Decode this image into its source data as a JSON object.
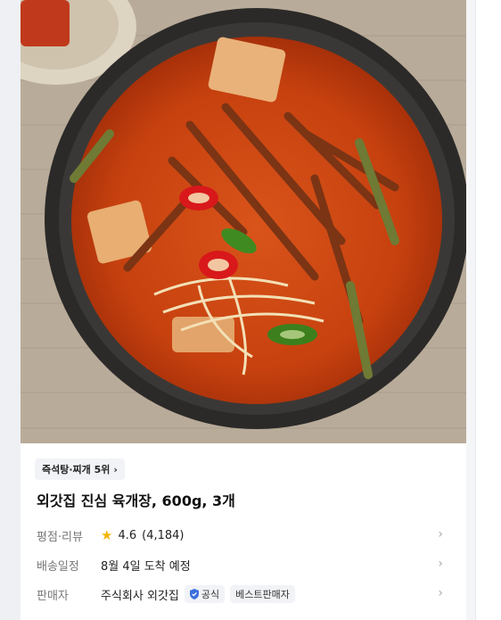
{
  "product": {
    "rank_label": "즉석탕·찌개 5위",
    "title": "외갓집 진심 육개장, 600g, 3개"
  },
  "rows": {
    "rating": {
      "label": "평점·리뷰",
      "score": "4.6",
      "count": "(4,184)"
    },
    "delivery": {
      "label": "배송일정",
      "value": "8월 4일 도착 예정"
    },
    "seller": {
      "label": "판매자",
      "value": "주식회사 외갓집",
      "official_badge": "공식",
      "best_badge": "베스트판매자"
    }
  },
  "icons": {
    "chevron": "›",
    "star": "★"
  },
  "colors": {
    "star": "#f5b400",
    "verified": "#3b6fe0"
  }
}
